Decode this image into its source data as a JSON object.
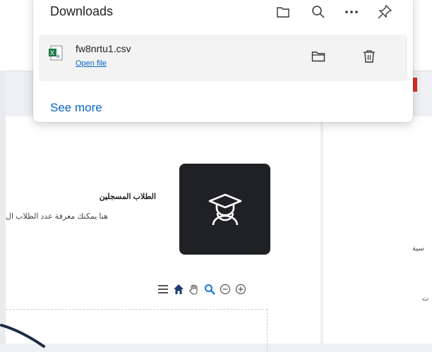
{
  "downloads": {
    "title": "Downloads",
    "file": {
      "name": "fw8nrtu1.csv",
      "open_label": "Open file"
    },
    "see_more": "See more"
  },
  "card": {
    "title": "الطلاب المسجلين",
    "description": "هنا يمكنك معرفة عدد الطلاب ال",
    "icon": "graduate-icon"
  },
  "right_panel": {
    "text1": "سية",
    "text2": "ت"
  },
  "colors": {
    "accent": "#0a66c2",
    "card_bg": "#202124"
  }
}
